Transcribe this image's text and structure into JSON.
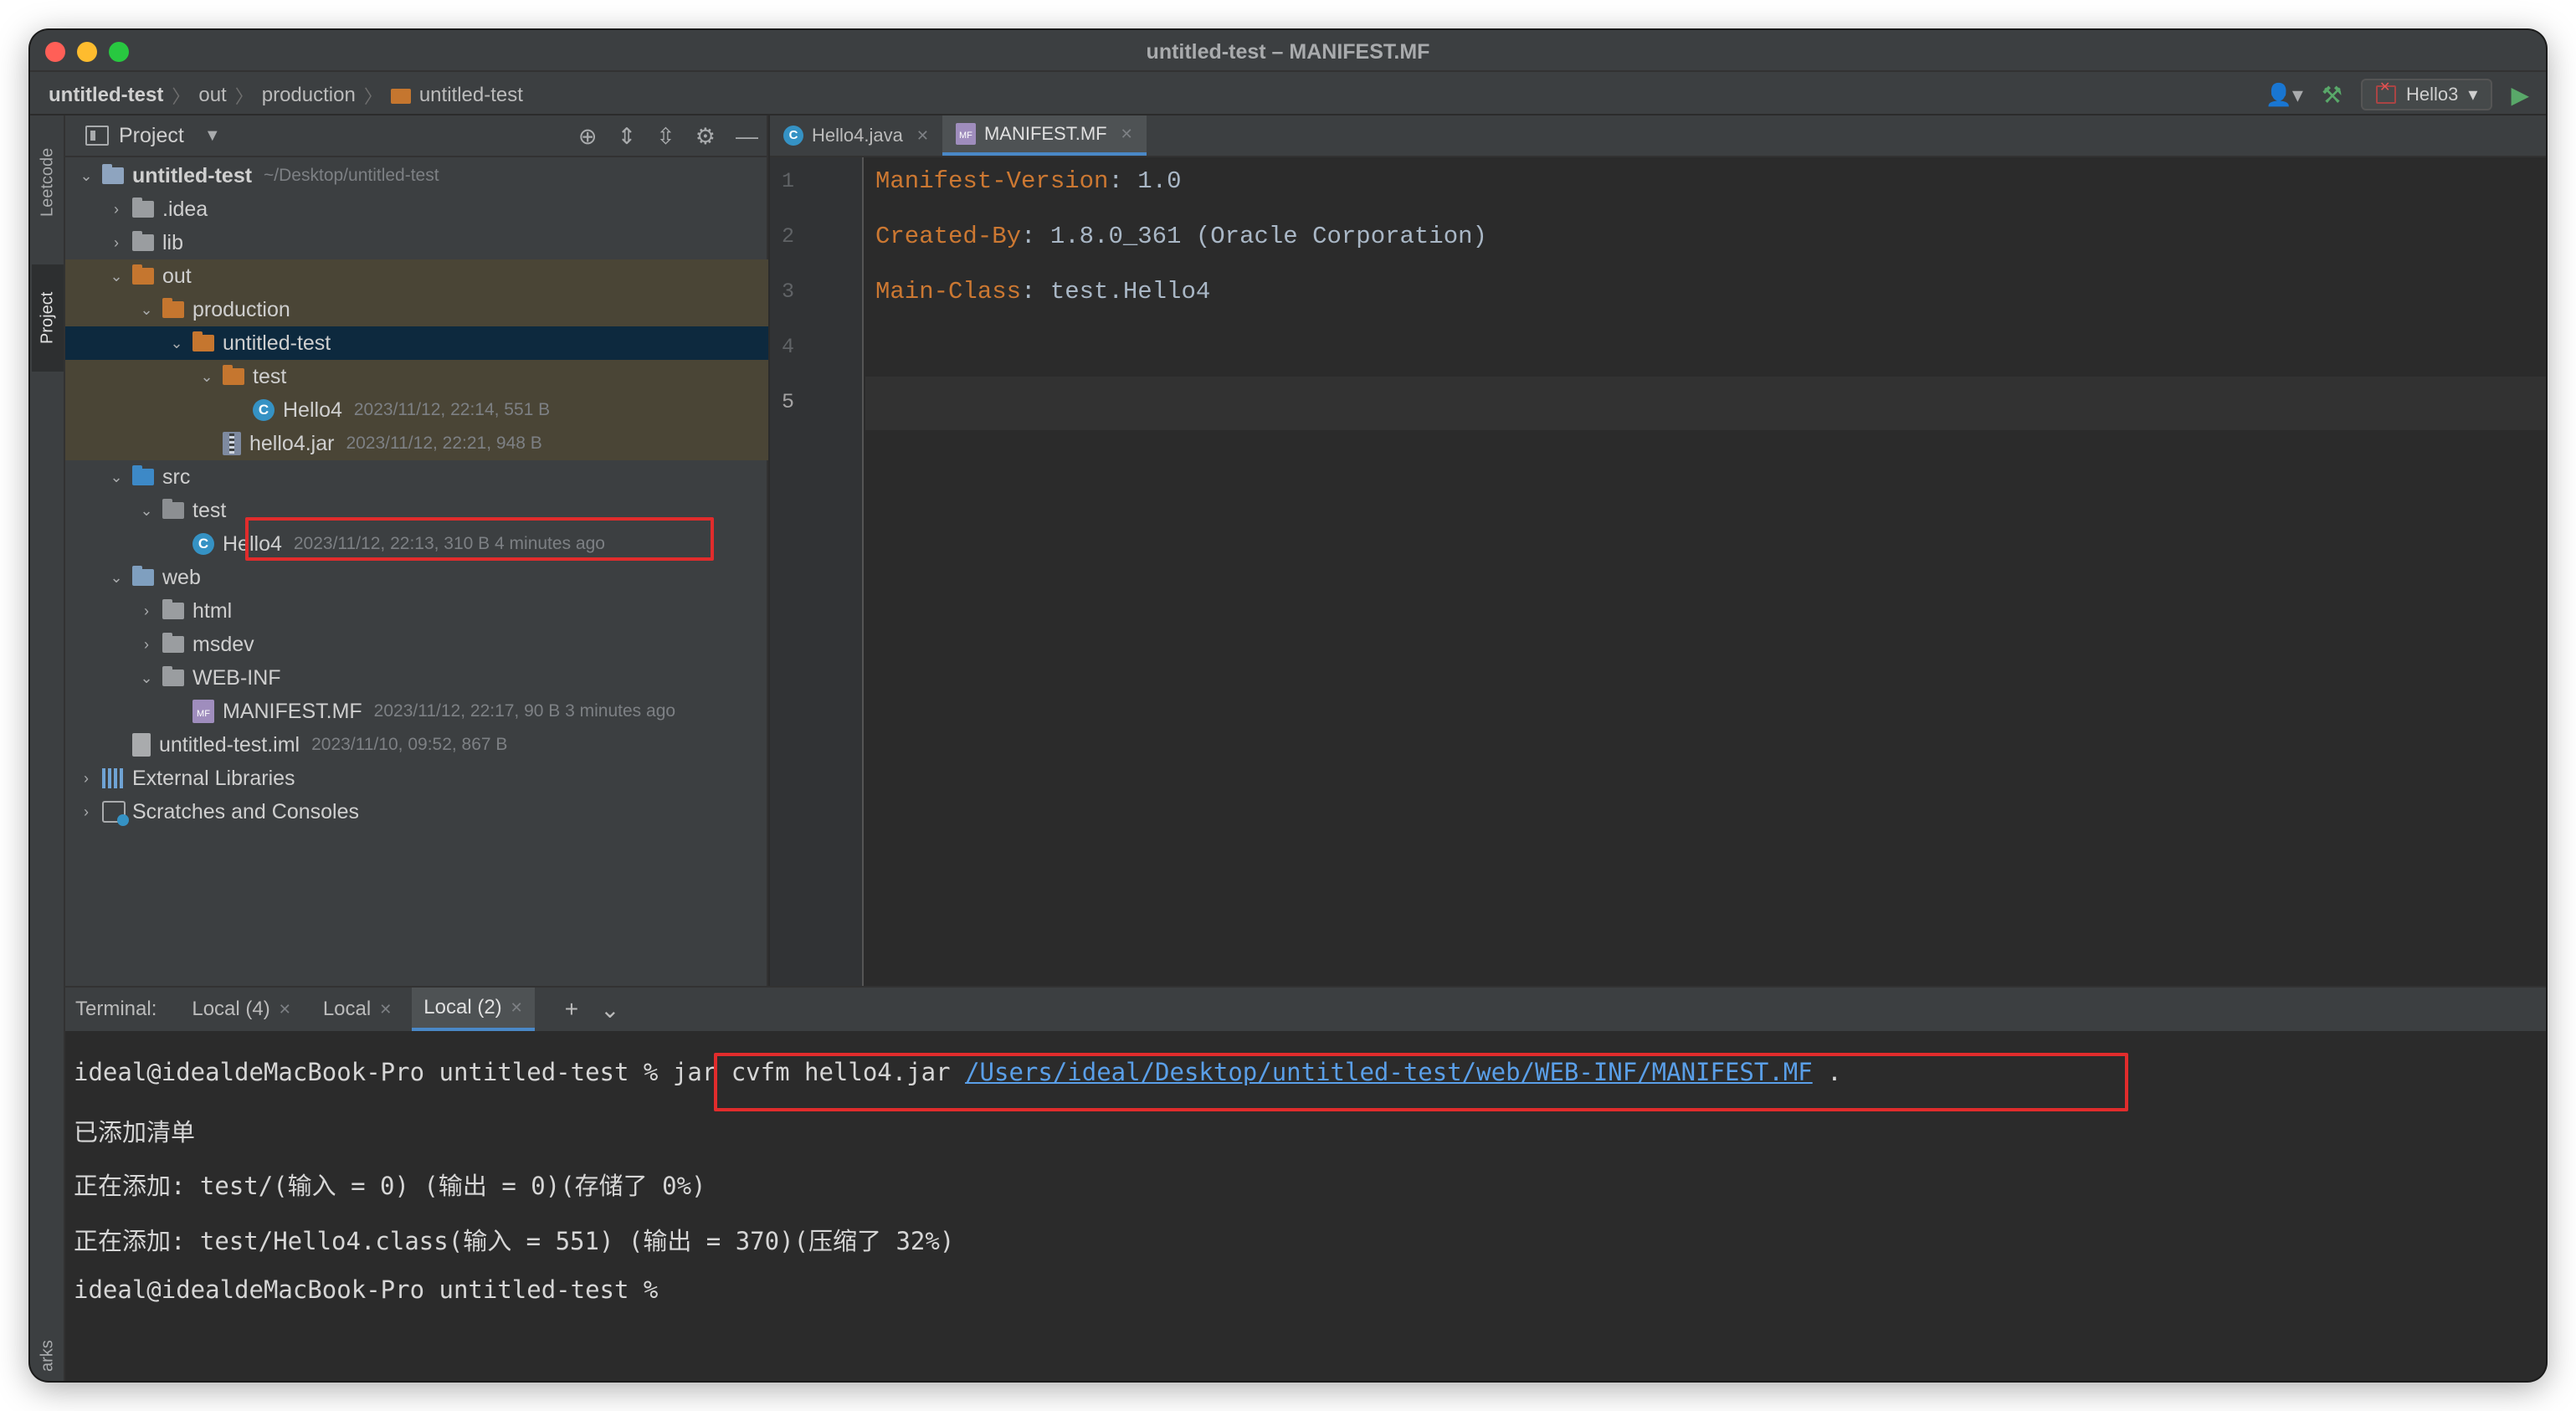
{
  "window": {
    "title": "untitled-test – MANIFEST.MF"
  },
  "breadcrumb": [
    "untitled-test",
    "out",
    "production",
    "untitled-test"
  ],
  "toolbar": {
    "run_config": "Hello3"
  },
  "left_stripe": {
    "leetcode": "Leetcode",
    "project": "Project",
    "bookmarks": "arks"
  },
  "project_panel": {
    "title": "Project",
    "tree": [
      {
        "name": "untitled-test",
        "meta": "~/Desktop/untitled-test",
        "bold": true
      },
      {
        "name": ".idea",
        "meta": ""
      },
      {
        "name": "lib",
        "meta": ""
      },
      {
        "name": "out",
        "meta": ""
      },
      {
        "name": "production",
        "meta": ""
      },
      {
        "name": "untitled-test",
        "meta": ""
      },
      {
        "name": "test",
        "meta": ""
      },
      {
        "name": "Hello4",
        "meta": "2023/11/12, 22:14, 551 B"
      },
      {
        "name": "hello4.jar",
        "meta": "2023/11/12, 22:21, 948 B"
      },
      {
        "name": "src",
        "meta": ""
      },
      {
        "name": "test",
        "meta": ""
      },
      {
        "name": "Hello4",
        "meta": "2023/11/12, 22:13, 310 B 4 minutes ago"
      },
      {
        "name": "web",
        "meta": ""
      },
      {
        "name": "html",
        "meta": ""
      },
      {
        "name": "msdev",
        "meta": ""
      },
      {
        "name": "WEB-INF",
        "meta": ""
      },
      {
        "name": "MANIFEST.MF",
        "meta": "2023/11/12, 22:17, 90 B 3 minutes ago"
      },
      {
        "name": "untitled-test.iml",
        "meta": "2023/11/10, 09:52, 867 B"
      },
      {
        "name": "External Libraries",
        "meta": ""
      },
      {
        "name": "Scratches and Consoles",
        "meta": ""
      }
    ]
  },
  "editor": {
    "tabs": [
      {
        "label": "Hello4.java",
        "active": false
      },
      {
        "label": "MANIFEST.MF",
        "active": true
      }
    ],
    "line_numbers": [
      "1",
      "2",
      "3",
      "4",
      "5"
    ],
    "lines": [
      {
        "key": "Manifest-Version",
        "value": ": 1.0"
      },
      {
        "key": "Created-By",
        "value": ": 1.8.0_361 (Oracle Corporation)"
      },
      {
        "key": "Main-Class",
        "value": ": test.Hello4"
      }
    ]
  },
  "terminal": {
    "label": "Terminal:",
    "tabs": [
      {
        "label": "Local (4)",
        "active": false
      },
      {
        "label": "Local",
        "active": false
      },
      {
        "label": "Local (2)",
        "active": true
      }
    ],
    "prompt": "ideal@idealdeMacBook-Pro untitled-test %",
    "command": "jar cvfm hello4.jar",
    "command_path": "/Users/ideal/Desktop/untitled-test/web/WEB-INF/MANIFEST.MF",
    "command_tail": ".",
    "output": [
      "已添加清单",
      "正在添加: test/(输入 = 0) (输出 = 0)(存储了 0%)",
      "正在添加: test/Hello4.class(输入 = 551) (输出 = 370)(压缩了 32%)"
    ],
    "final_prompt": "ideal@idealdeMacBook-Pro untitled-test %"
  },
  "colors": {
    "accent": "#4a88c7",
    "highlight_box": "#e12c2c",
    "folder_out": "#c5762f",
    "key": "#cc7832"
  }
}
